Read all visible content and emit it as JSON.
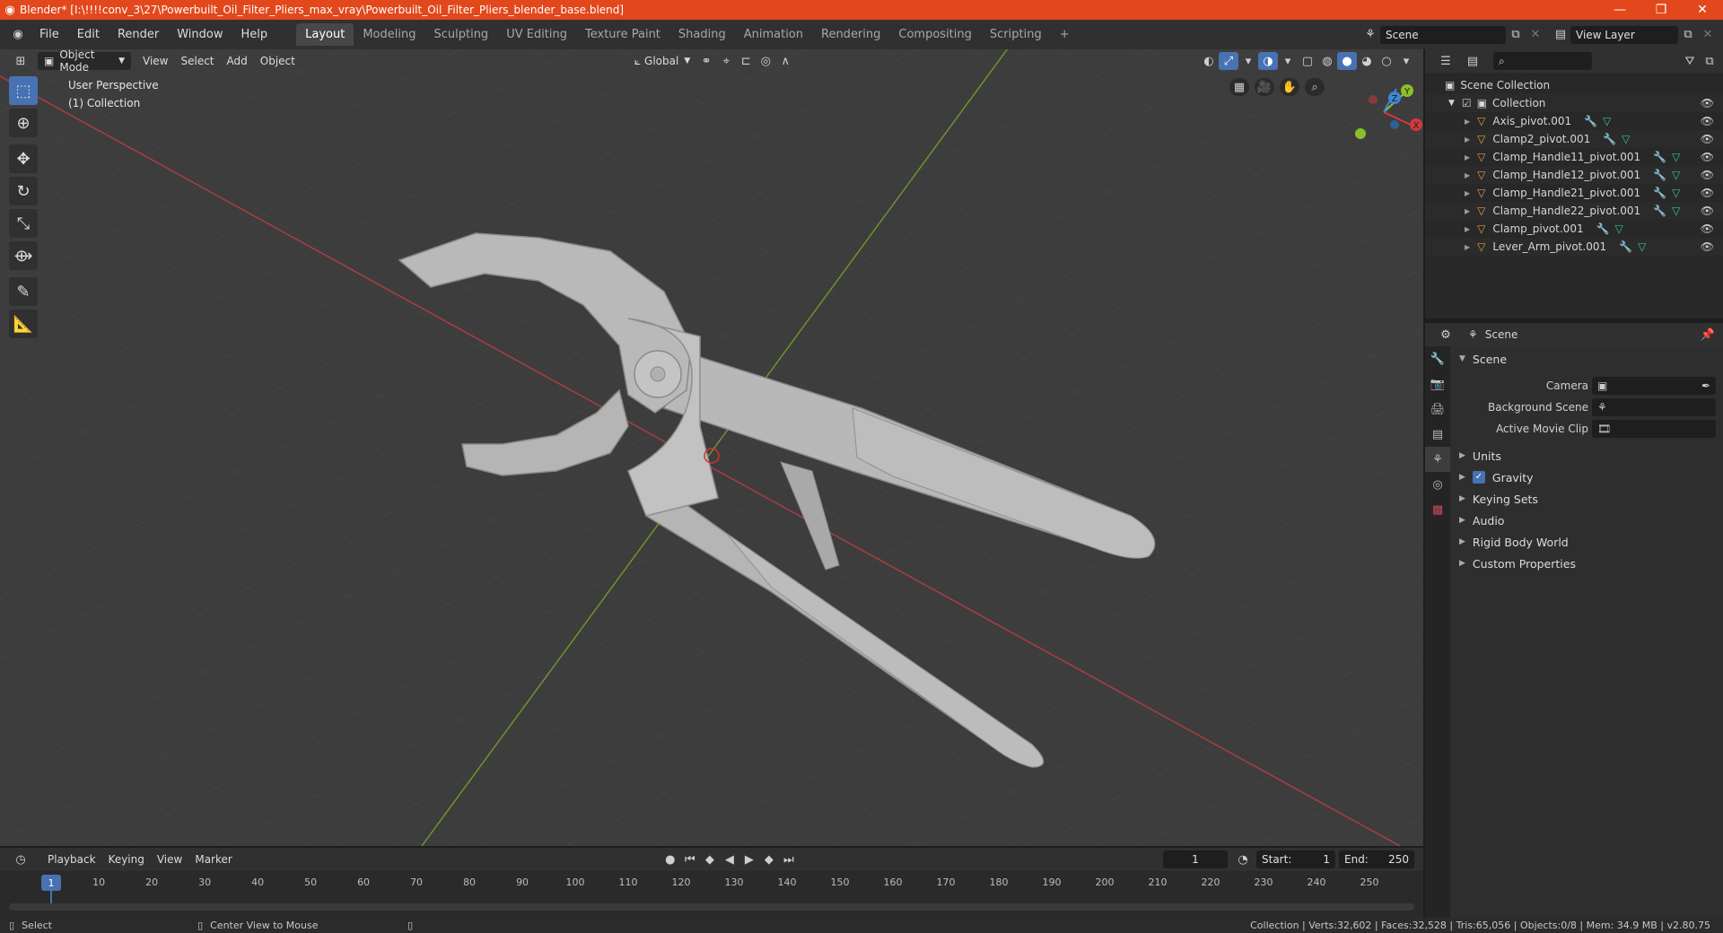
{
  "window": {
    "title": "Blender* [I:\\!!!!conv_3\\27\\Powerbuilt_Oil_Filter_Pliers_max_vray\\Powerbuilt_Oil_Filter_Pliers_blender_base.blend]",
    "minimize": "—",
    "maximize": "❐",
    "close": "✕"
  },
  "menu": [
    "File",
    "Edit",
    "Render",
    "Window",
    "Help"
  ],
  "workspaces": [
    {
      "label": "Layout",
      "active": true
    },
    {
      "label": "Modeling"
    },
    {
      "label": "Sculpting"
    },
    {
      "label": "UV Editing"
    },
    {
      "label": "Texture Paint"
    },
    {
      "label": "Shading"
    },
    {
      "label": "Animation"
    },
    {
      "label": "Rendering"
    },
    {
      "label": "Compositing"
    },
    {
      "label": "Scripting"
    }
  ],
  "add_workspace": "+",
  "scene_selector": {
    "value": "Scene"
  },
  "view_layer_selector": {
    "value": "View Layer"
  },
  "viewport": {
    "mode": "Object Mode",
    "menus": [
      "View",
      "Select",
      "Add",
      "Object"
    ],
    "transform_orientation": "Global",
    "info_line1": "User Perspective",
    "info_line2": "(1) Collection",
    "gizmo": {
      "x": "X",
      "y": "Y",
      "z": "Z"
    }
  },
  "outliner": {
    "scene_collection": "Scene Collection",
    "collection": "Collection",
    "objects": [
      "Axis_pivot.001",
      "Clamp2_pivot.001",
      "Clamp_Handle11_pivot.001",
      "Clamp_Handle12_pivot.001",
      "Clamp_Handle21_pivot.001",
      "Clamp_Handle22_pivot.001",
      "Clamp_pivot.001",
      "Lever_Arm_pivot.001"
    ]
  },
  "properties": {
    "context": "Scene",
    "panel_title": "Scene",
    "camera_label": "Camera",
    "background_scene_label": "Background Scene",
    "active_movie_clip_label": "Active Movie Clip",
    "sections": [
      "Units",
      "Gravity",
      "Keying Sets",
      "Audio",
      "Rigid Body World",
      "Custom Properties"
    ],
    "gravity_checked": true
  },
  "timeline": {
    "menus": [
      "Playback",
      "Keying",
      "View",
      "Marker"
    ],
    "current_frame": "1",
    "start_label": "Start:",
    "start": "1",
    "end_label": "End:",
    "end": "250",
    "ticks": [
      "1",
      "10",
      "20",
      "30",
      "40",
      "50",
      "60",
      "70",
      "80",
      "90",
      "100",
      "110",
      "120",
      "130",
      "140",
      "150",
      "160",
      "170",
      "180",
      "190",
      "200",
      "210",
      "220",
      "230",
      "240",
      "250"
    ]
  },
  "statusbar": {
    "select": "Select",
    "center_view": "Center View to Mouse",
    "stats": "Collection | Verts:32,602 | Faces:32,528 | Tris:65,056 | Objects:0/8 | Mem: 34.9 MB | v2.80.75"
  },
  "colors": {
    "titlebar": "#e2481c",
    "accent": "#4772b3",
    "x_axis": "#d3383e",
    "y_axis": "#8cbf2c",
    "z_axis": "#3d87d6",
    "object_icon": "#e89b45",
    "mesh_icon": "#2dc7a0"
  }
}
